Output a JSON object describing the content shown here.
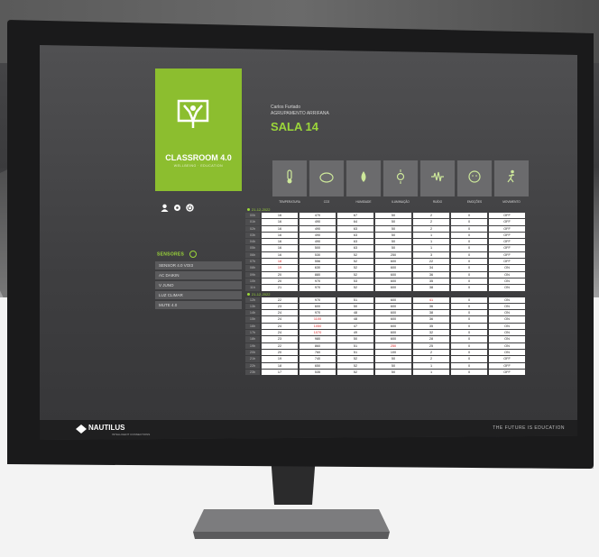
{
  "brand": {
    "title": "CLASSROOM 4.0",
    "subtitle": "WELLBEING · EDUCATION"
  },
  "school": {
    "line1": "Carlos Furtado",
    "line2": "AGRUPAMENTO ARRIFANA"
  },
  "room": "SALA 14",
  "sensors": {
    "title": "SENSORES",
    "items": [
      "SENSOR 4.0 VOI3",
      "AC DAIKIN",
      "V JUNO",
      "LUZ CLIMAR",
      "MUTE 4.0"
    ]
  },
  "categories": [
    {
      "label": "TEMPERATURA",
      "icon": "thermometer-icon"
    },
    {
      "label": "CO2",
      "icon": "co2-cloud-icon"
    },
    {
      "label": "HUMIDADE",
      "icon": "droplet-icon"
    },
    {
      "label": "ILUMINAÇÃO",
      "icon": "sun-icon"
    },
    {
      "label": "RUÍDO",
      "icon": "noise-wave-icon"
    },
    {
      "label": "EMOÇÕES",
      "icon": "face-icon"
    },
    {
      "label": "MOVIMENTO",
      "icon": "person-motion-icon"
    }
  ],
  "days": [
    {
      "date": "21-12-2022",
      "rows": [
        [
          "00h",
          "16",
          "470",
          "67",
          "50",
          "2",
          "0",
          "OFF"
        ],
        [
          "01h",
          "16",
          "490",
          "64",
          "50",
          "2",
          "0",
          "OFF"
        ],
        [
          "02h",
          "16",
          "490",
          "63",
          "50",
          "2",
          "0",
          "OFF"
        ],
        [
          "03h",
          "16",
          "490",
          "63",
          "50",
          "1",
          "0",
          "OFF"
        ],
        [
          "04h",
          "16",
          "490",
          "63",
          "50",
          "1",
          "0",
          "OFF"
        ],
        [
          "05h",
          "16",
          "500",
          "63",
          "50",
          "1",
          "0",
          "OFF"
        ],
        [
          "06h",
          "16",
          "530",
          "52",
          "250",
          "3",
          "0",
          "OFF"
        ],
        [
          "07h",
          "18",
          "556",
          "52",
          "600",
          "22",
          "0",
          "OFF"
        ],
        [
          "08h",
          "19",
          "630",
          "52",
          "600",
          "34",
          "0",
          "ON"
        ],
        [
          "09h",
          "20",
          "880",
          "52",
          "600",
          "36",
          "0",
          "ON"
        ],
        [
          "10h",
          "20",
          "970",
          "53",
          "600",
          "35",
          "0",
          "ON"
        ],
        [
          "11h",
          "21",
          "970",
          "52",
          "600",
          "38",
          "0",
          "ON"
        ]
      ]
    },
    {
      "date": "21-12-2022",
      "rows": [
        [
          "12h",
          "22",
          "970",
          "51",
          "600",
          "41",
          "0",
          "ON"
        ],
        [
          "13h",
          "23",
          "600",
          "50",
          "600",
          "36",
          "0",
          "ON"
        ],
        [
          "14h",
          "24",
          "970",
          "48",
          "600",
          "38",
          "0",
          "ON"
        ],
        [
          "15h",
          "24",
          "1100",
          "48",
          "600",
          "36",
          "0",
          "ON"
        ],
        [
          "16h",
          "24",
          "1050",
          "47",
          "600",
          "35",
          "0",
          "ON"
        ],
        [
          "17h",
          "24",
          "1070",
          "49",
          "600",
          "32",
          "0",
          "ON"
        ],
        [
          "18h",
          "23",
          "980",
          "50",
          "600",
          "28",
          "0",
          "ON"
        ],
        [
          "19h",
          "22",
          "860",
          "51",
          "250",
          "25",
          "0",
          "ON"
        ],
        [
          "20h",
          "20",
          "760",
          "51",
          "100",
          "2",
          "0",
          "ON"
        ],
        [
          "21h",
          "19",
          "740",
          "52",
          "50",
          "2",
          "0",
          "OFF"
        ],
        [
          "22h",
          "18",
          "650",
          "52",
          "50",
          "1",
          "0",
          "OFF"
        ],
        [
          "23h",
          "17",
          "535",
          "52",
          "50",
          "1",
          "0",
          "OFF"
        ]
      ]
    }
  ],
  "alerts": {
    "red_cells": [
      [
        0,
        7,
        1
      ],
      [
        0,
        8,
        1
      ],
      [
        1,
        0,
        5
      ],
      [
        1,
        3,
        2
      ],
      [
        1,
        4,
        2
      ],
      [
        1,
        5,
        2
      ],
      [
        1,
        7,
        4
      ]
    ]
  },
  "footer": {
    "brand": "NAUTILUS",
    "tagline": "INTELLIGENT CONNECTIONS",
    "motto": "THE FUTURE IS EDUCATION"
  },
  "colors": {
    "accent": "#8cbe2f",
    "alert": "#d92222"
  }
}
